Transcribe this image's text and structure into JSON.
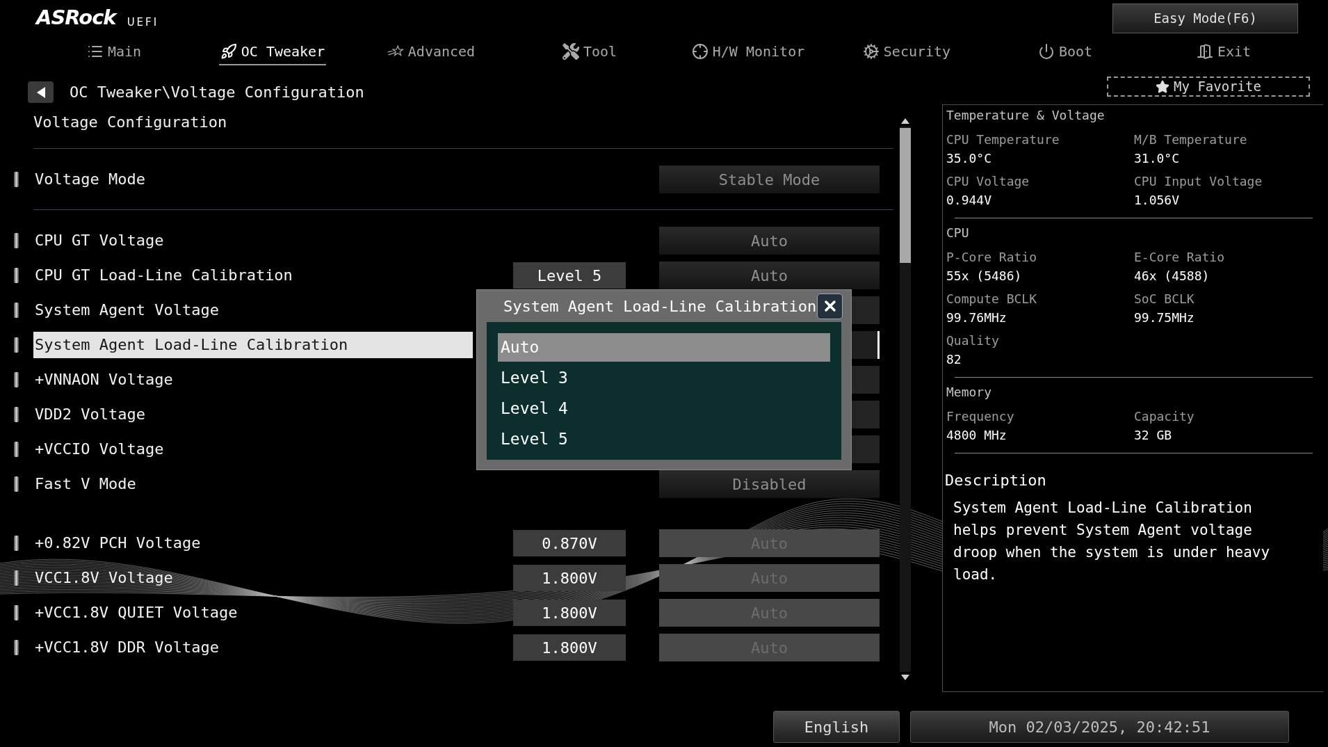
{
  "header": {
    "logo": "ASRock",
    "logo_suffix": "UEFI",
    "mode_button": "Easy Mode(F6)"
  },
  "tabs": [
    {
      "label": "Main",
      "selected": false
    },
    {
      "label": "OC Tweaker",
      "selected": true
    },
    {
      "label": "Advanced",
      "selected": false
    },
    {
      "label": "Tool",
      "selected": false
    },
    {
      "label": "H/W Monitor",
      "selected": false
    },
    {
      "label": "Security",
      "selected": false
    },
    {
      "label": "Boot",
      "selected": false
    },
    {
      "label": "Exit",
      "selected": false
    }
  ],
  "breadcrumb": "OC Tweaker\\Voltage Configuration",
  "page_title": "Voltage Configuration",
  "mode_row": {
    "label": "Voltage Mode",
    "option": "Stable Mode",
    "option_disabled": false,
    "selected": false
  },
  "setting_groups": [
    [
      {
        "label": "CPU GT Voltage",
        "option": "Auto",
        "option_disabled": false,
        "selected": false
      },
      {
        "label": "CPU GT Load-Line Calibration",
        "value": "Level 5",
        "option": "Auto",
        "option_disabled": false,
        "selected": false
      },
      {
        "label": "System Agent Voltage",
        "selected": false
      },
      {
        "label": "System Agent Load-Line Calibration",
        "selected": true
      },
      {
        "label": "+VNNAON Voltage",
        "selected": false
      },
      {
        "label": "VDD2 Voltage",
        "selected": false
      },
      {
        "label": "+VCCIO Voltage",
        "selected": false
      },
      {
        "label": "Fast V Mode",
        "option": "Disabled",
        "option_disabled": false,
        "selected": false
      }
    ],
    [
      {
        "label": "+0.82V PCH Voltage",
        "value": "0.870V",
        "option": "Auto",
        "option_disabled": true,
        "selected": false
      },
      {
        "label": "VCC1.8V Voltage",
        "value": "1.800V",
        "option": "Auto",
        "option_disabled": true,
        "selected": false
      },
      {
        "label": "+VCC1.8V QUIET Voltage",
        "value": "1.800V",
        "option": "Auto",
        "option_disabled": true,
        "selected": false
      },
      {
        "label": "+VCC1.8V DDR Voltage",
        "value": "1.800V",
        "option": "Auto",
        "option_disabled": true,
        "selected": false
      }
    ]
  ],
  "popup": {
    "title": "System Agent Load-Line Calibration",
    "options": [
      {
        "label": "Auto",
        "selected": true
      },
      {
        "label": "Level 3",
        "selected": false
      },
      {
        "label": "Level 4",
        "selected": false
      },
      {
        "label": "Level 5",
        "selected": false
      }
    ]
  },
  "favorite_button": "My Favorite",
  "info_sections": [
    {
      "title": "Temperature & Voltage",
      "items": [
        {
          "label": "CPU Temperature",
          "value": "35.0°C"
        },
        {
          "label": "M/B Temperature",
          "value": "31.0°C"
        },
        {
          "label": "CPU Voltage",
          "value": "0.944V"
        },
        {
          "label": "CPU Input Voltage",
          "value": "1.056V"
        }
      ]
    },
    {
      "title": "CPU",
      "items": [
        {
          "label": "P-Core Ratio",
          "value": "55x (5486)"
        },
        {
          "label": "E-Core Ratio",
          "value": "46x (4588)"
        },
        {
          "label": "Compute BCLK",
          "value": "99.76MHz"
        },
        {
          "label": "SoC BCLK",
          "value": "99.75MHz"
        },
        {
          "label": "Quality",
          "value": "82"
        }
      ]
    },
    {
      "title": "Memory",
      "items": [
        {
          "label": "Frequency",
          "value": "4800 MHz"
        },
        {
          "label": "Capacity",
          "value": "32 GB"
        }
      ]
    }
  ],
  "description": {
    "title": "Description",
    "text": "System Agent Load-Line Calibration helps prevent System Agent voltage droop when the system is under heavy load."
  },
  "footer": {
    "language_button": "English",
    "datetime": "Mon 02/03/2025, 20:42:51"
  }
}
